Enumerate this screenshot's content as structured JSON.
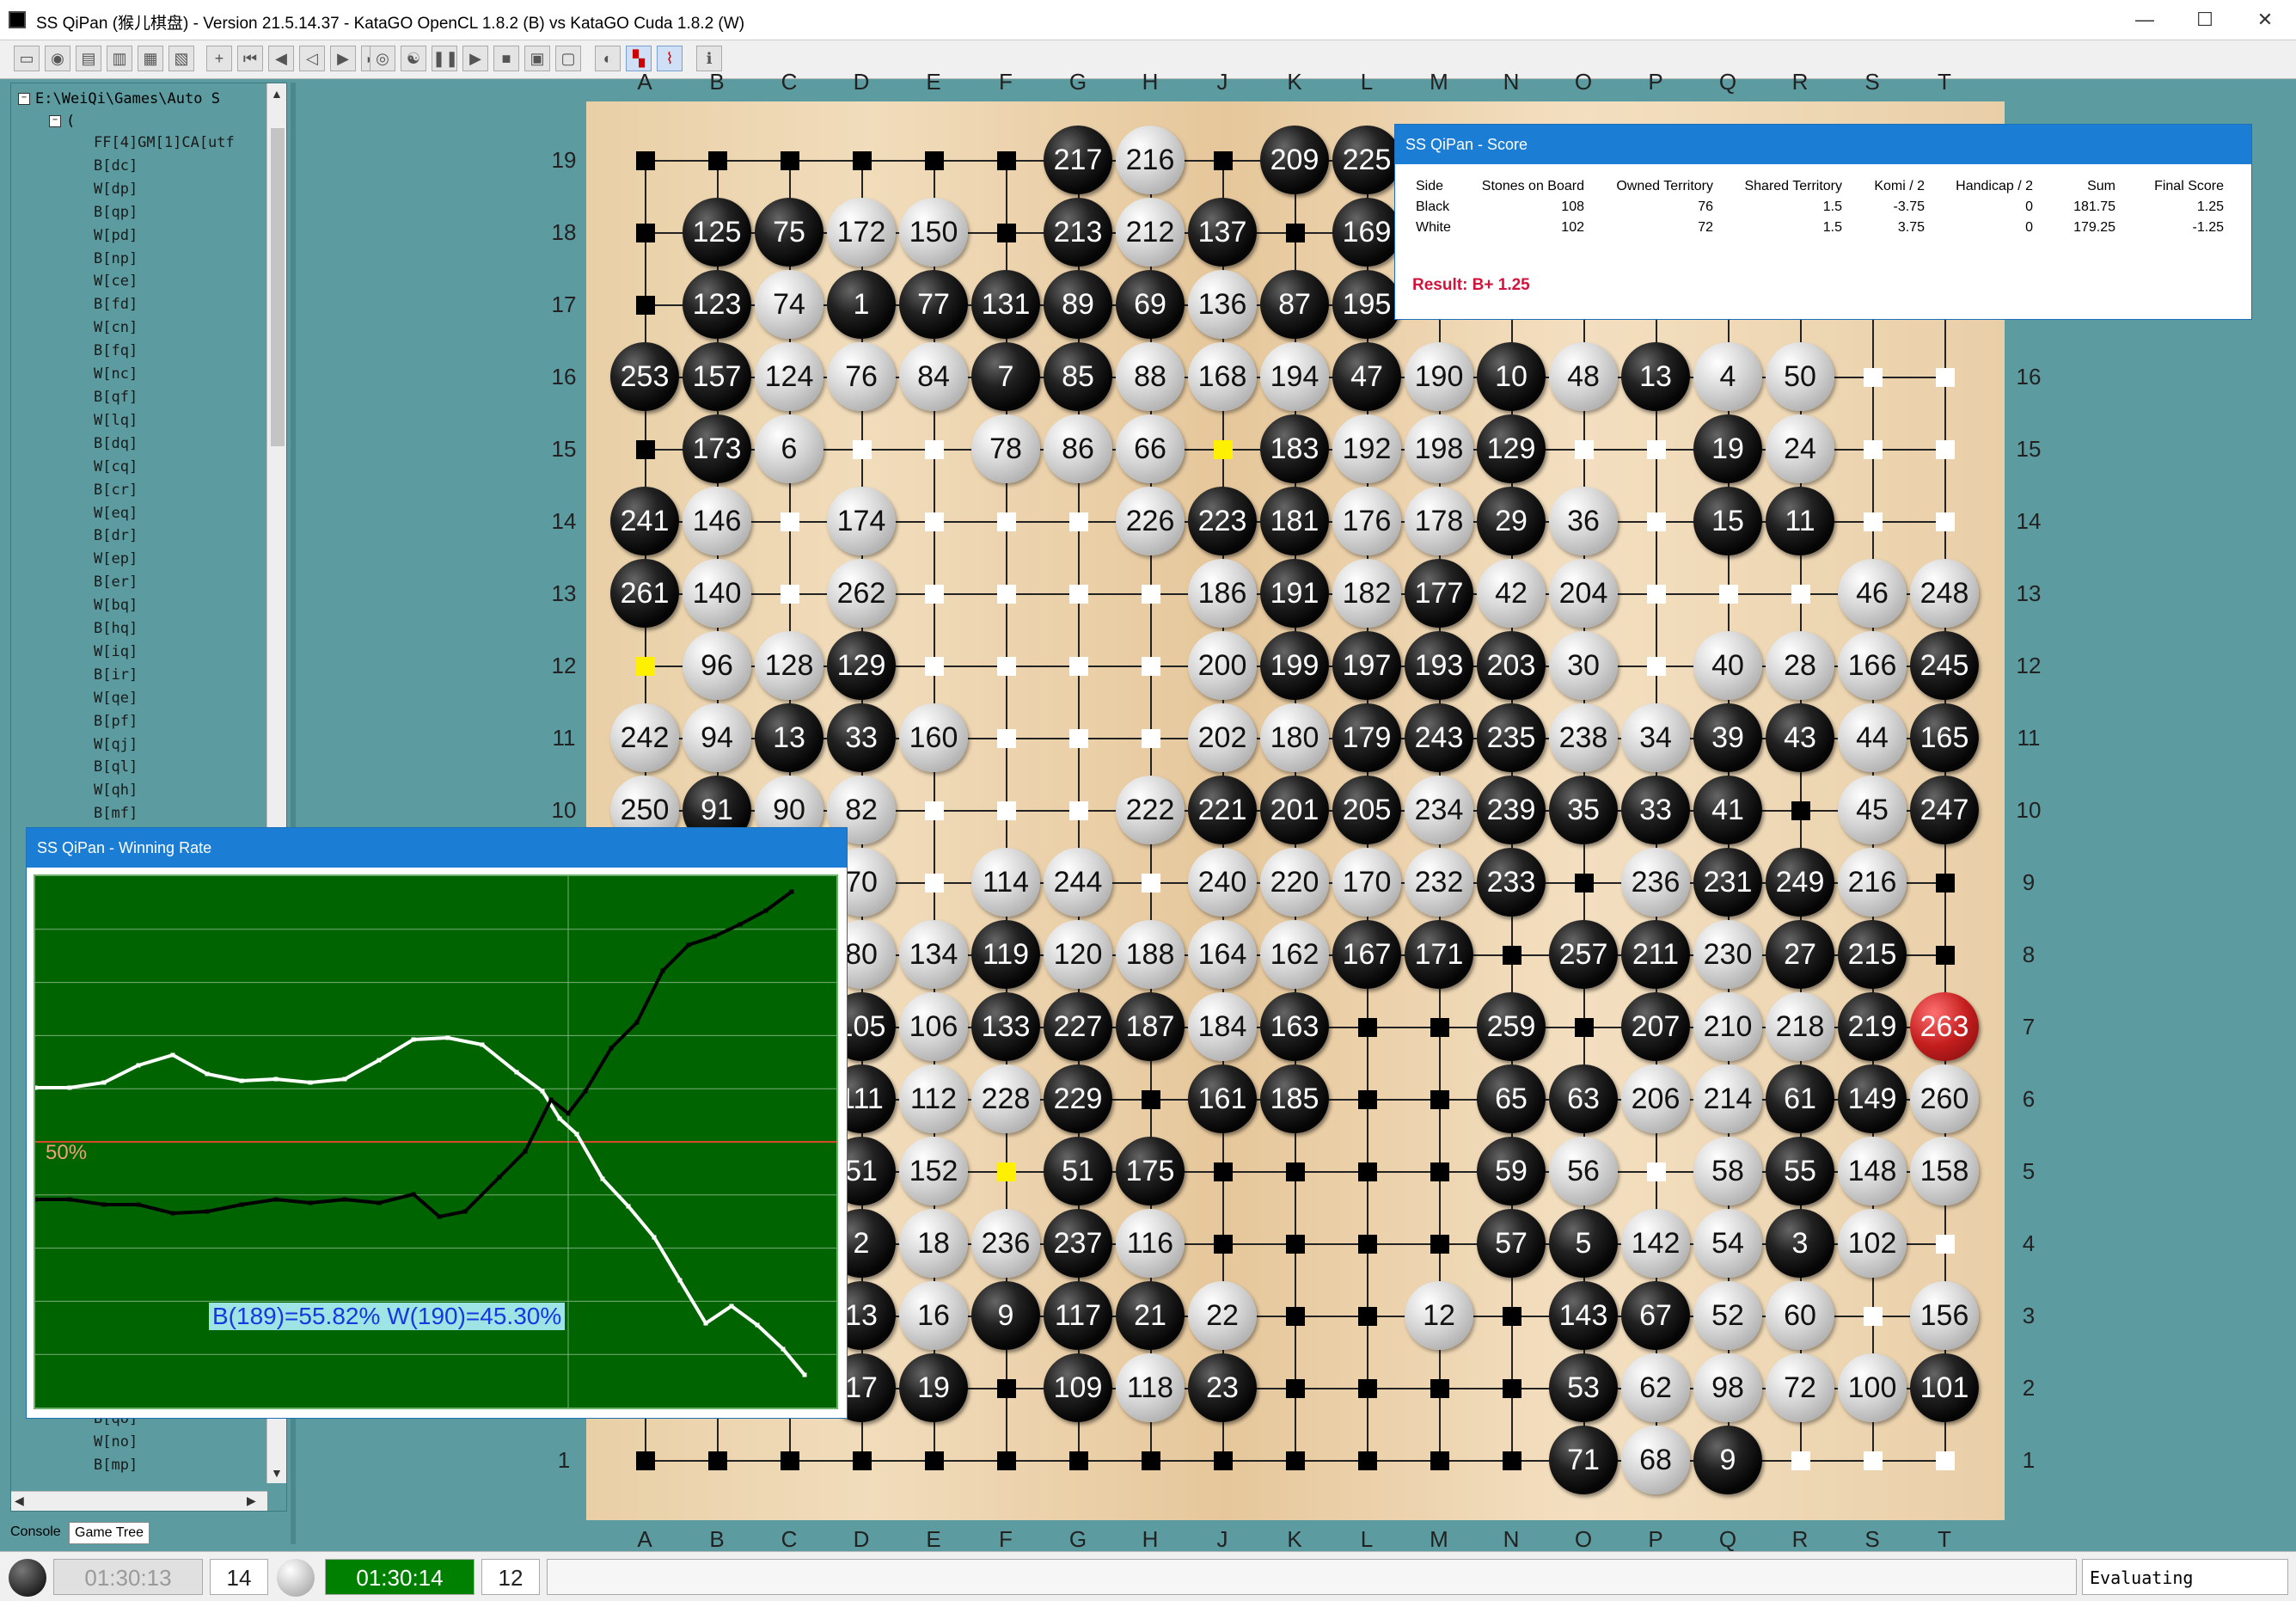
{
  "window": {
    "title": "SS QiPan (猴儿棋盘) - Version 21.5.14.37 - KataGO OpenCL 1.8.2 (B) vs KataGO Cuda 1.8.2 (W)",
    "controls": [
      "—",
      "☐",
      "✕"
    ]
  },
  "toolbar": {
    "buttons": [
      "new-file",
      "open-file",
      "save-file",
      "export",
      "cut",
      "paste",
      "add",
      "first-move",
      "prev-move",
      "back",
      "forward",
      "last-move",
      "target",
      "yin-yang",
      "pause",
      "play",
      "stop",
      "tile",
      "window",
      "layout",
      "eye",
      "analysis",
      "chart",
      "info"
    ]
  },
  "tree": {
    "root_path": "E:\\WeiQi\\Games\\Auto S",
    "open_paren": "(",
    "items": [
      "FF[4]GM[1]CA[utf",
      "B[dc]",
      "W[dp]",
      "B[qp]",
      "W[pd]",
      "B[np]",
      "W[ce]",
      "B[fd]",
      "W[cn]",
      "B[fq]",
      "W[nc]",
      "B[qf]",
      "W[lq]",
      "B[dq]",
      "W[cq]",
      "B[cr]",
      "W[eq]",
      "B[dr]",
      "W[ep]",
      "B[er]",
      "W[bq]",
      "B[hq]",
      "W[iq]",
      "B[ir]",
      "W[qe]",
      "B[pf]",
      "W[qj]",
      "B[ql]",
      "W[qh]",
      "B[mf]"
    ],
    "bottom_items": [
      "B[qo]",
      "W[no]",
      "B[mp]"
    ]
  },
  "tabs": [
    "Console",
    "Game Tree"
  ],
  "board": {
    "col_labels": [
      "A",
      "B",
      "C",
      "D",
      "E",
      "F",
      "G",
      "H",
      "J",
      "K",
      "L",
      "M",
      "N",
      "O",
      "P",
      "Q",
      "R",
      "S",
      "T"
    ],
    "row_labels": [
      "19",
      "18",
      "17",
      "16",
      "15",
      "14",
      "13",
      "12",
      "11",
      "10",
      "9",
      "8",
      "7",
      "6",
      "5",
      "4",
      "3",
      "2",
      "1"
    ],
    "last_move": "263"
  },
  "score_panel": {
    "title": "SS QiPan - Score",
    "headers": [
      "Side",
      "Stones on Board",
      "Owned Territory",
      "Shared Territory",
      "Komi / 2",
      "Handicap / 2",
      "Sum",
      "Final Score"
    ],
    "rows": [
      [
        "Black",
        "108",
        "76",
        "1.5",
        "-3.75",
        "0",
        "181.75",
        "1.25"
      ],
      [
        "White",
        "102",
        "72",
        "1.5",
        "3.75",
        "0",
        "179.25",
        "-1.25"
      ]
    ],
    "result": "Result: B+ 1.25"
  },
  "winrate_panel": {
    "title": "SS QiPan - Winning Rate",
    "midline_label": "50%",
    "readout": "B(189)=55.82% W(190)=45.30%",
    "black_rate": 55.82,
    "white_rate": 45.3
  },
  "statusbar": {
    "black_time": "01:30:13",
    "black_captures": "14",
    "white_time": "01:30:14",
    "white_captures": "12",
    "status": "Evaluating"
  }
}
